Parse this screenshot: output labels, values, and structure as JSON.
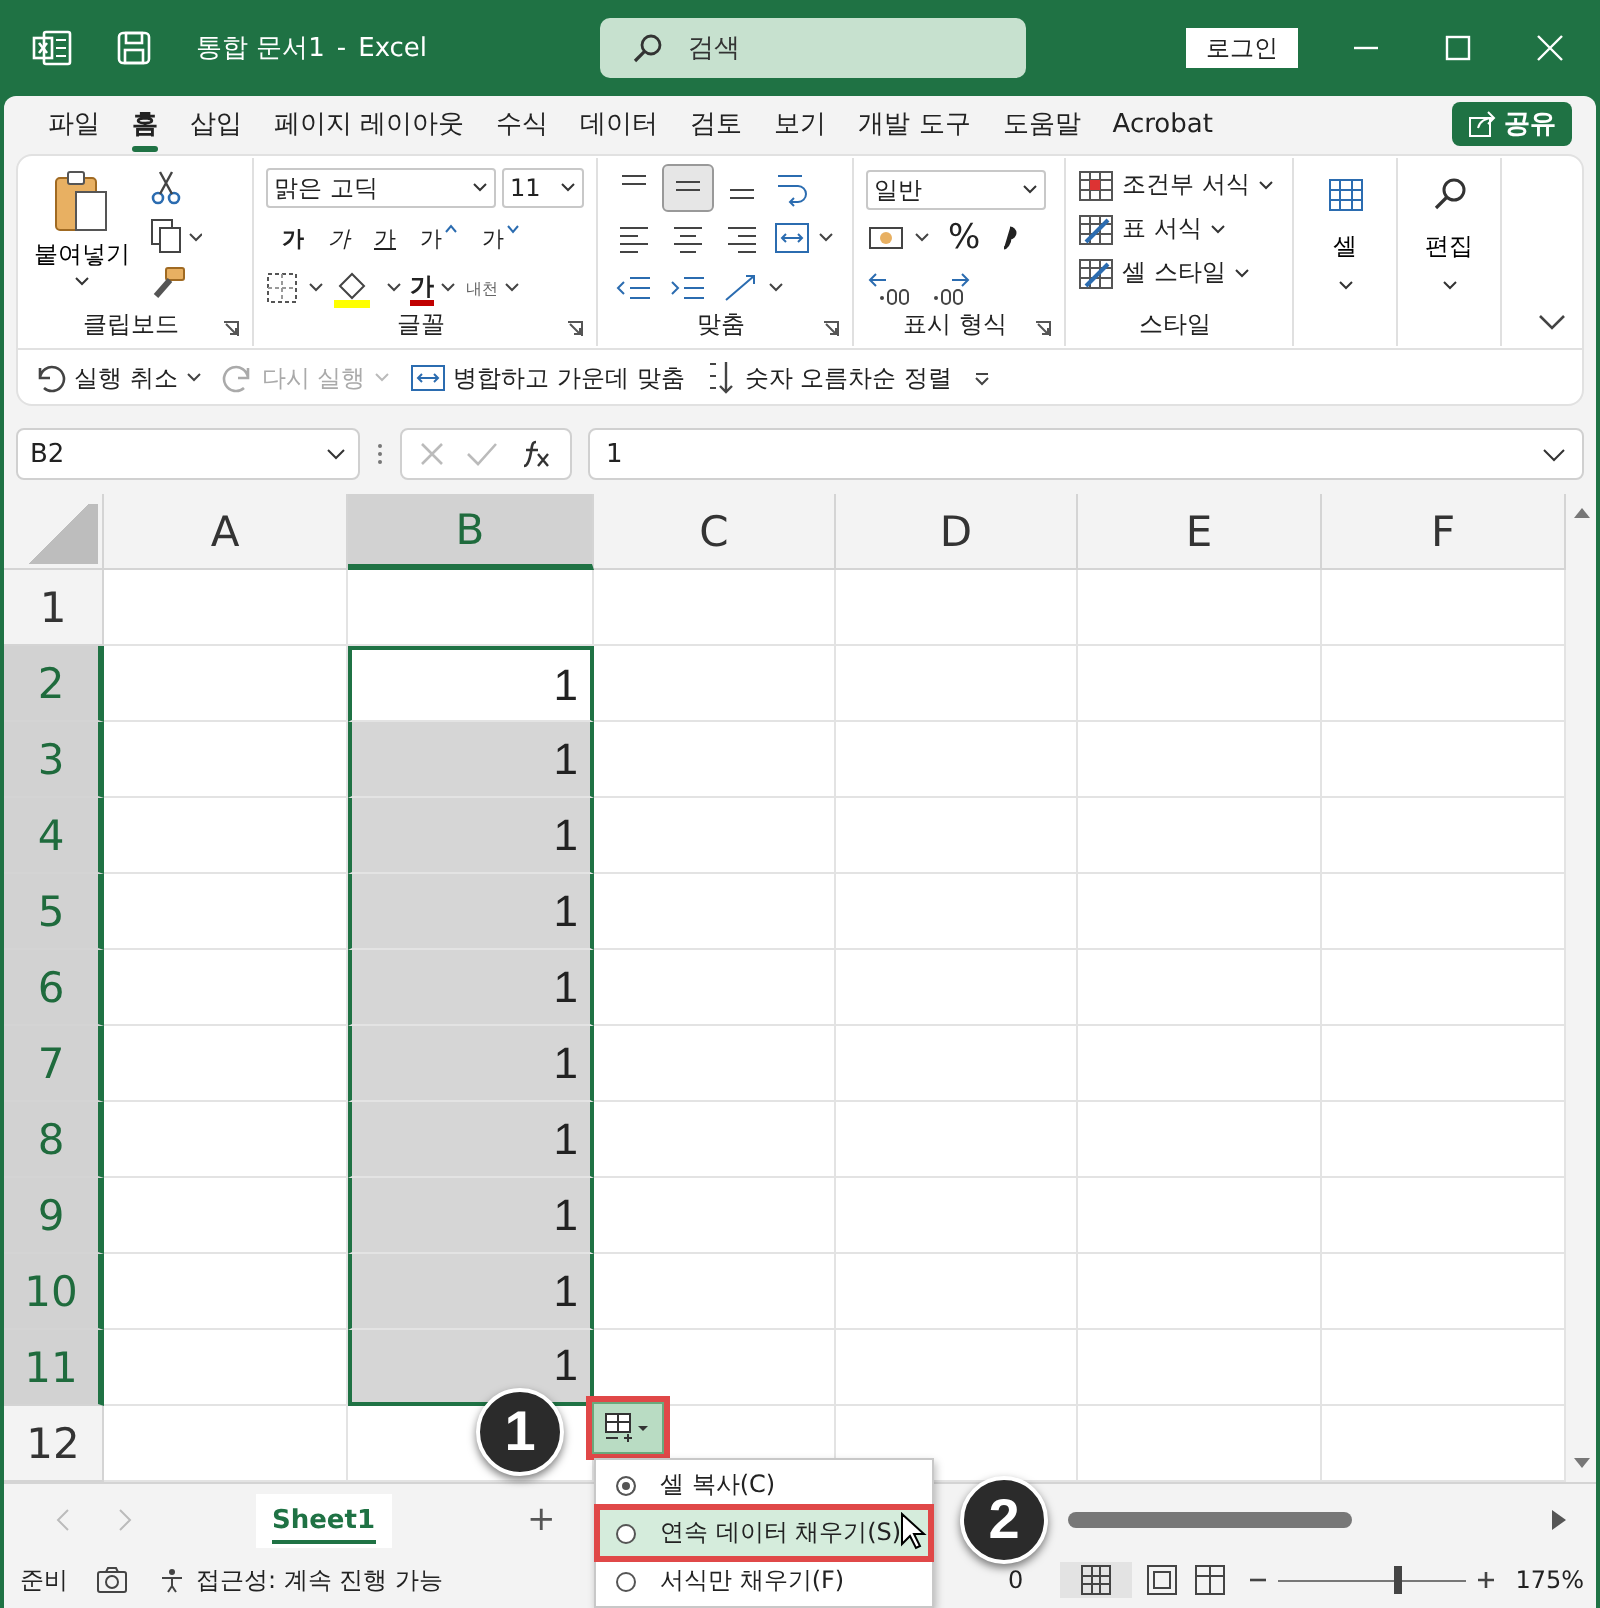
{
  "window": {
    "file_name": "통합 문서1",
    "separator": "-",
    "app_name": "Excel",
    "search": {
      "placeholder": "검색"
    },
    "login_button": "로그인"
  },
  "ribbon_tabs": [
    {
      "label": "파일",
      "selected": false
    },
    {
      "label": "홈",
      "selected": true
    },
    {
      "label": "삽입",
      "selected": false
    },
    {
      "label": "페이지 레이아웃",
      "selected": false
    },
    {
      "label": "수식",
      "selected": false
    },
    {
      "label": "데이터",
      "selected": false
    },
    {
      "label": "검토",
      "selected": false
    },
    {
      "label": "보기",
      "selected": false
    },
    {
      "label": "개발 도구",
      "selected": false
    },
    {
      "label": "도움말",
      "selected": false
    },
    {
      "label": "Acrobat",
      "selected": false
    }
  ],
  "share_button": "공유",
  "ribbon": {
    "clipboard": {
      "paste": "붙여넣기",
      "label": "클립보드"
    },
    "font": {
      "name": "맑은 고딕",
      "size": "11",
      "buttons": [
        {
          "kind": "bold",
          "label": "가"
        },
        {
          "kind": "italic",
          "label": "가"
        },
        {
          "kind": "underline",
          "label": "가"
        },
        {
          "kind": "grow",
          "label": "가"
        },
        {
          "kind": "shrink",
          "label": "가"
        }
      ],
      "font_color_label": "가",
      "phonetic": "내천",
      "label": "글꼴"
    },
    "alignment": {
      "vertical": [
        {
          "selected": false
        },
        {
          "selected": true
        },
        {
          "selected": false
        }
      ],
      "label": "맞춤"
    },
    "number": {
      "format": "일반",
      "percent": "%",
      "label": "표시 형식"
    },
    "styles": {
      "items": [
        "조건부 서식",
        "표 서식",
        "셀 스타일"
      ],
      "label": "스타일"
    },
    "cells": {
      "label": "셀"
    },
    "editing": {
      "label": "편집"
    }
  },
  "quick_access": [
    {
      "kind": "undo",
      "label": "실행 취소",
      "disabled": false
    },
    {
      "kind": "redo",
      "label": "다시 실행",
      "disabled": true
    },
    {
      "kind": "merge",
      "label": "병합하고 가운데 맞춤",
      "disabled": false
    },
    {
      "kind": "sort",
      "label": "숫자 오름차순 정렬",
      "disabled": false
    }
  ],
  "formula_bar": {
    "name_box": "B2",
    "value": "1"
  },
  "sheet": {
    "columns": [
      {
        "label": "A",
        "selected": false
      },
      {
        "label": "B",
        "selected": true
      },
      {
        "label": "C",
        "selected": false
      },
      {
        "label": "D",
        "selected": false
      },
      {
        "label": "E",
        "selected": false
      },
      {
        "label": "F",
        "selected": false
      }
    ],
    "rows": [
      {
        "label": "1",
        "selected": false,
        "cells": [
          {
            "selected": false
          },
          {
            "selected": false
          },
          {
            "selected": false
          },
          {
            "selected": false
          },
          {
            "selected": false
          },
          {
            "selected": false
          }
        ]
      },
      {
        "label": "2",
        "selected": true,
        "cells": [
          {
            "selected": false
          },
          {
            "selected": true,
            "active": true,
            "value": "1"
          },
          {
            "selected": false
          },
          {
            "selected": false
          },
          {
            "selected": false
          },
          {
            "selected": false
          }
        ]
      },
      {
        "label": "3",
        "selected": true,
        "cells": [
          {
            "selected": false
          },
          {
            "selected": true,
            "value": "1"
          },
          {
            "selected": false
          },
          {
            "selected": false
          },
          {
            "selected": false
          },
          {
            "selected": false
          }
        ]
      },
      {
        "label": "4",
        "selected": true,
        "cells": [
          {
            "selected": false
          },
          {
            "selected": true,
            "value": "1"
          },
          {
            "selected": false
          },
          {
            "selected": false
          },
          {
            "selected": false
          },
          {
            "selected": false
          }
        ]
      },
      {
        "label": "5",
        "selected": true,
        "cells": [
          {
            "selected": false
          },
          {
            "selected": true,
            "value": "1"
          },
          {
            "selected": false
          },
          {
            "selected": false
          },
          {
            "selected": false
          },
          {
            "selected": false
          }
        ]
      },
      {
        "label": "6",
        "selected": true,
        "cells": [
          {
            "selected": false
          },
          {
            "selected": true,
            "value": "1"
          },
          {
            "selected": false
          },
          {
            "selected": false
          },
          {
            "selected": false
          },
          {
            "selected": false
          }
        ]
      },
      {
        "label": "7",
        "selected": true,
        "cells": [
          {
            "selected": false
          },
          {
            "selected": true,
            "value": "1"
          },
          {
            "selected": false
          },
          {
            "selected": false
          },
          {
            "selected": false
          },
          {
            "selected": false
          }
        ]
      },
      {
        "label": "8",
        "selected": true,
        "cells": [
          {
            "selected": false
          },
          {
            "selected": true,
            "value": "1"
          },
          {
            "selected": false
          },
          {
            "selected": false
          },
          {
            "selected": false
          },
          {
            "selected": false
          }
        ]
      },
      {
        "label": "9",
        "selected": true,
        "cells": [
          {
            "selected": false
          },
          {
            "selected": true,
            "value": "1"
          },
          {
            "selected": false
          },
          {
            "selected": false
          },
          {
            "selected": false
          },
          {
            "selected": false
          }
        ]
      },
      {
        "label": "10",
        "selected": true,
        "cells": [
          {
            "selected": false
          },
          {
            "selected": true,
            "value": "1"
          },
          {
            "selected": false
          },
          {
            "selected": false
          },
          {
            "selected": false
          },
          {
            "selected": false
          }
        ]
      },
      {
        "label": "11",
        "selected": true,
        "cells": [
          {
            "selected": false
          },
          {
            "selected": true,
            "value": "1"
          },
          {
            "selected": false
          },
          {
            "selected": false
          },
          {
            "selected": false
          },
          {
            "selected": false
          }
        ]
      },
      {
        "label": "12",
        "selected": false,
        "cells": [
          {
            "selected": false
          },
          {
            "selected": false
          },
          {
            "selected": false
          },
          {
            "selected": false
          },
          {
            "selected": false
          },
          {
            "selected": false
          }
        ]
      }
    ]
  },
  "autofill": {
    "annotated": true,
    "menu": [
      {
        "label": "셀 복사(C)",
        "selected": true,
        "highlighted": false
      },
      {
        "label": "연속 데이터 채우기(S)",
        "selected": false,
        "highlighted": true
      },
      {
        "label": "서식만 채우기(F)",
        "selected": false,
        "highlighted": false
      }
    ]
  },
  "callouts": [
    "1",
    "2"
  ],
  "sheet_tabs": [
    {
      "label": "Sheet1",
      "selected": true
    }
  ],
  "add_sheet": "+",
  "status_bar": {
    "ready": "준비",
    "accessibility": "접근성: 계속 진행 가능",
    "aggregate": "0",
    "zoom_slider": {
      "level": 0.64
    },
    "zoom": "175%"
  }
}
